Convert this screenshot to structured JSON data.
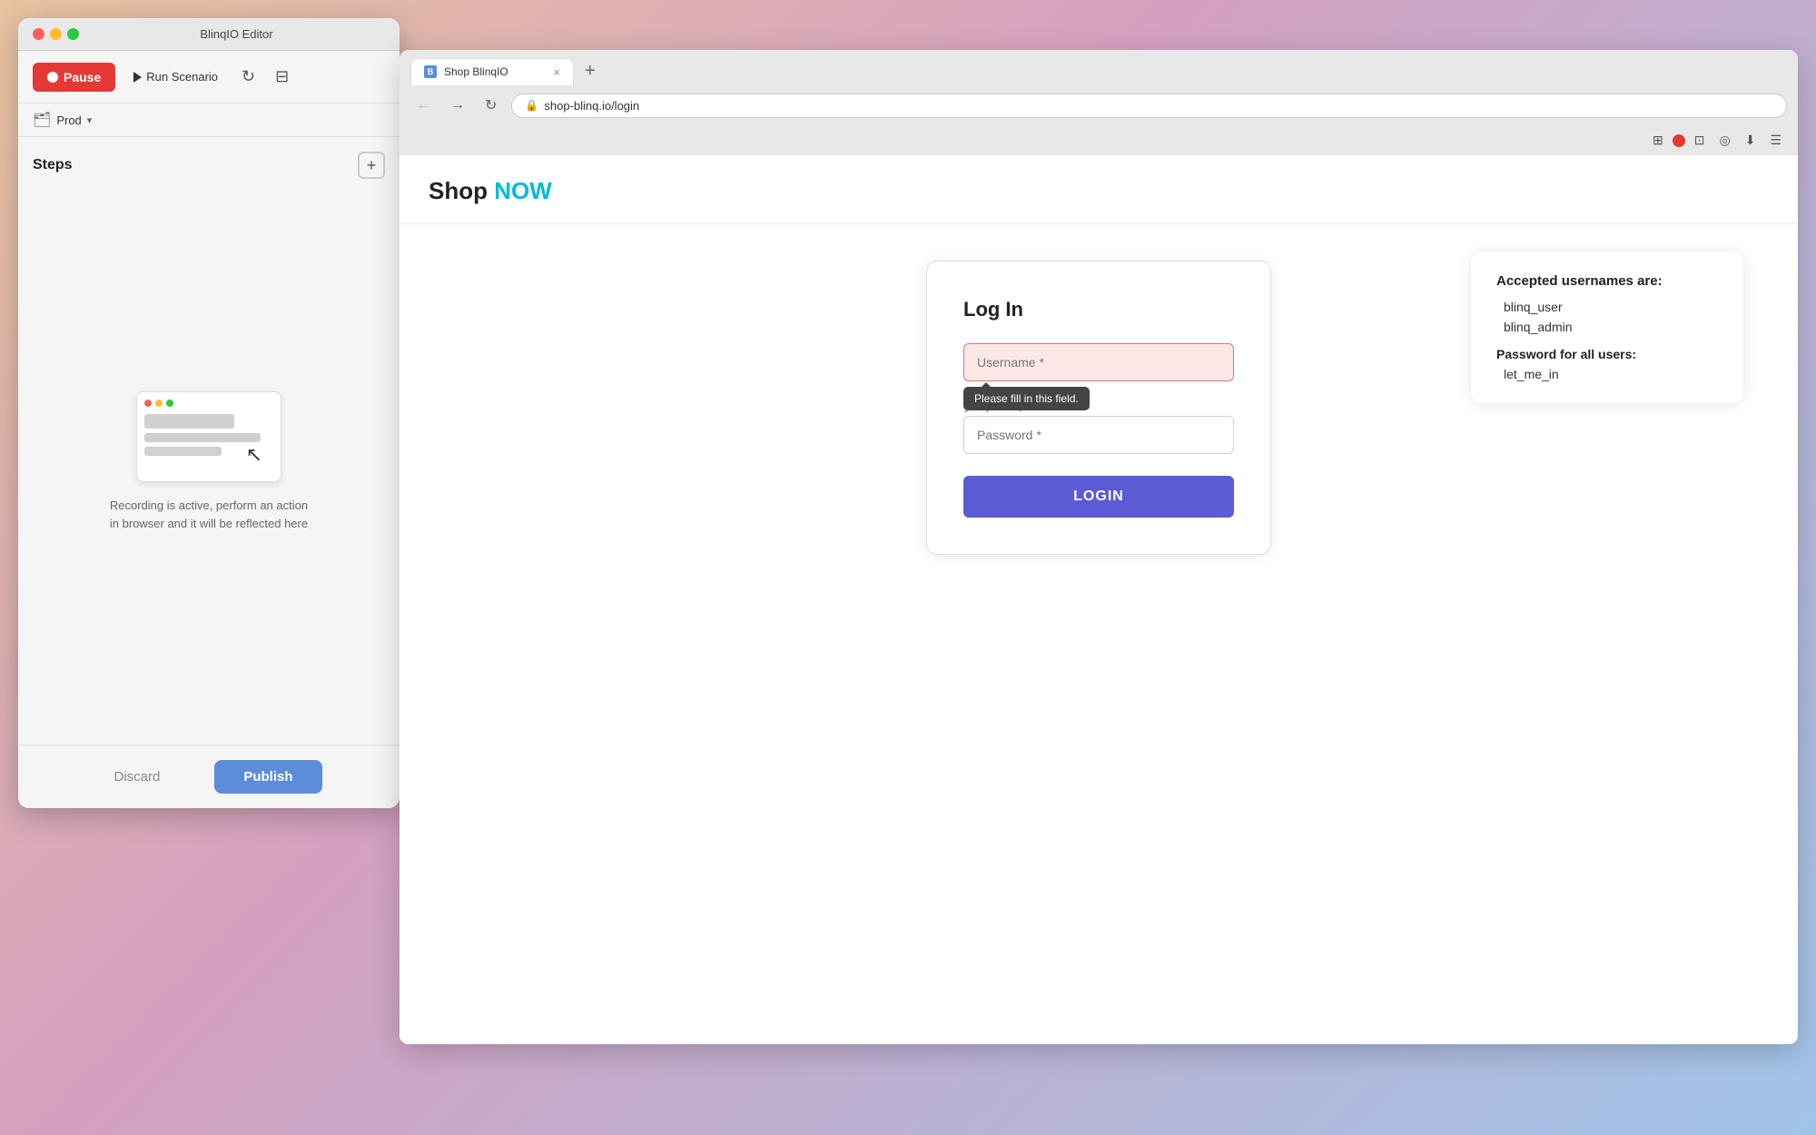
{
  "editor": {
    "title": "BlinqIO Editor",
    "traffic_lights": [
      "red",
      "yellow",
      "green"
    ],
    "pause_button": "Pause",
    "run_scenario_button": "Run Scenario",
    "env_label": "Prod",
    "steps_title": "Steps",
    "recording_text_line1": "Recording is active, perform an action",
    "recording_text_line2": "in browser and it will be reflected here",
    "discard_button": "Discard",
    "publish_button": "Publish"
  },
  "browser": {
    "tab_title": "Shop BlinqIO",
    "url": "shop-blinq.io/login",
    "new_tab_label": "+",
    "tab_close": "×"
  },
  "page": {
    "shop_title_part1": "Shop ",
    "shop_title_part2": "NOW",
    "login": {
      "title": "Log In",
      "username_placeholder": "Username *",
      "password_placeholder": "Password *",
      "username_value": "",
      "tooltip": "Please fill in this field.",
      "getby_text": "getByLabel('Usern...",
      "login_button": "LOGIN"
    },
    "info_card": {
      "title": "Accepted usernames are:",
      "users": [
        "blinq_user",
        "blinq_admin"
      ],
      "password_section_label": "Password for all users:",
      "password_value": "let_me_in"
    }
  },
  "toolbar_icons": {
    "grid": "⊞",
    "record": "●",
    "pointer": "⊡",
    "eye": "◎",
    "download": "⬇",
    "menu": "☰"
  }
}
